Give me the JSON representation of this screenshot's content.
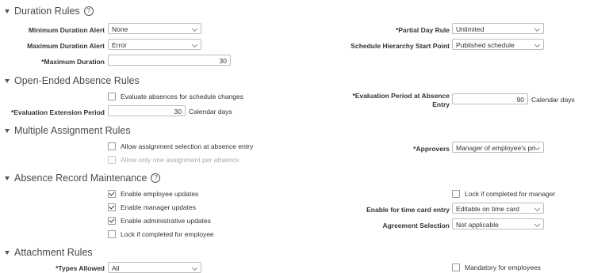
{
  "sections": {
    "duration": {
      "title": "Duration Rules",
      "help_icon": "help-circle-icon",
      "min_alert_label": "Minimum Duration Alert",
      "min_alert_value": "None",
      "max_alert_label": "Maximum Duration Alert",
      "max_alert_value": "Error",
      "max_duration_label": "Maximum Duration",
      "max_duration_value": "30",
      "partial_day_label": "Partial Day Rule",
      "partial_day_value": "Unlimited",
      "schedule_hierarchy_label": "Schedule Hierarchy Start Point",
      "schedule_hierarchy_value": "Published schedule"
    },
    "open_ended": {
      "title": "Open-Ended Absence Rules",
      "evaluate_label": "Evaluate absences for schedule changes",
      "ext_period_label": "Evaluation Extension Period",
      "ext_period_value": "30",
      "ext_period_unit": "Calendar days",
      "eval_period_label_line1": "Evaluation Period at Absence",
      "eval_period_label_line2": "Entry",
      "eval_period_value": "90",
      "eval_period_unit": "Calendar days"
    },
    "multiple_assignment": {
      "title": "Multiple Assignment Rules",
      "allow_selection_label": "Allow assignment selection at absence entry",
      "allow_one_label": "Allow only one assignment per absence",
      "approvers_label": "Approvers",
      "approvers_value": "Manager of employee's pri"
    },
    "record_maintenance": {
      "title": "Absence Record Maintenance",
      "help_icon": "help-circle-icon",
      "employee_updates_label": "Enable employee updates",
      "manager_updates_label": "Enable manager updates",
      "admin_updates_label": "Enable administrative updates",
      "lock_employee_label": "Lock if completed for employee",
      "lock_manager_label": "Lock if completed for manager",
      "time_card_label": "Enable for time card entry",
      "time_card_value": "Editable on time card",
      "agreement_label": "Agreement Selection",
      "agreement_value": "Not applicable"
    },
    "attachment": {
      "title": "Attachment Rules",
      "types_allowed_label": "Types Allowed",
      "types_allowed_value": "All",
      "mandatory_label": "Mandatory for employees"
    }
  },
  "required_marker": "*"
}
